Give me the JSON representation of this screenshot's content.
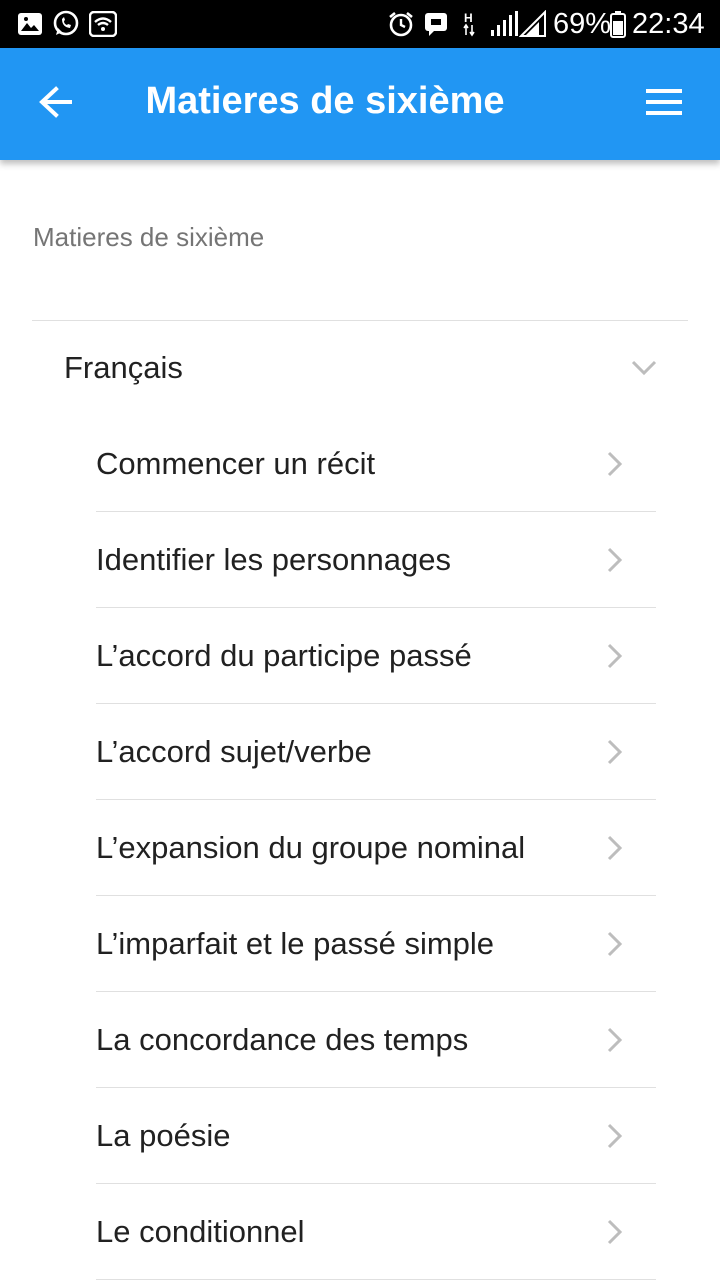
{
  "status_bar": {
    "battery": "69%",
    "time": "22:34",
    "network": "H",
    "icons": [
      "gallery-icon",
      "whatsapp-icon",
      "wifi-hotspot-icon",
      "alarm-icon",
      "message-icon",
      "network-h-icon",
      "signal-icon",
      "battery-icon"
    ]
  },
  "app_bar": {
    "title": "Matieres de sixième",
    "back_icon": "arrow-left-icon",
    "menu_icon": "hamburger-menu-icon",
    "color": "#2196F3"
  },
  "breadcrumb": "Matieres de sixième",
  "section": {
    "label": "Français",
    "expanded": true,
    "items": [
      {
        "label": "Commencer un récit"
      },
      {
        "label": "Identifier les personnages"
      },
      {
        "label": "L’accord du participe passé"
      },
      {
        "label": "L’accord sujet/verbe"
      },
      {
        "label": "L’expansion du groupe nominal"
      },
      {
        "label": "L’imparfait et le passé simple"
      },
      {
        "label": "La concordance des temps"
      },
      {
        "label": "La poésie"
      },
      {
        "label": "Le conditionnel"
      }
    ]
  }
}
